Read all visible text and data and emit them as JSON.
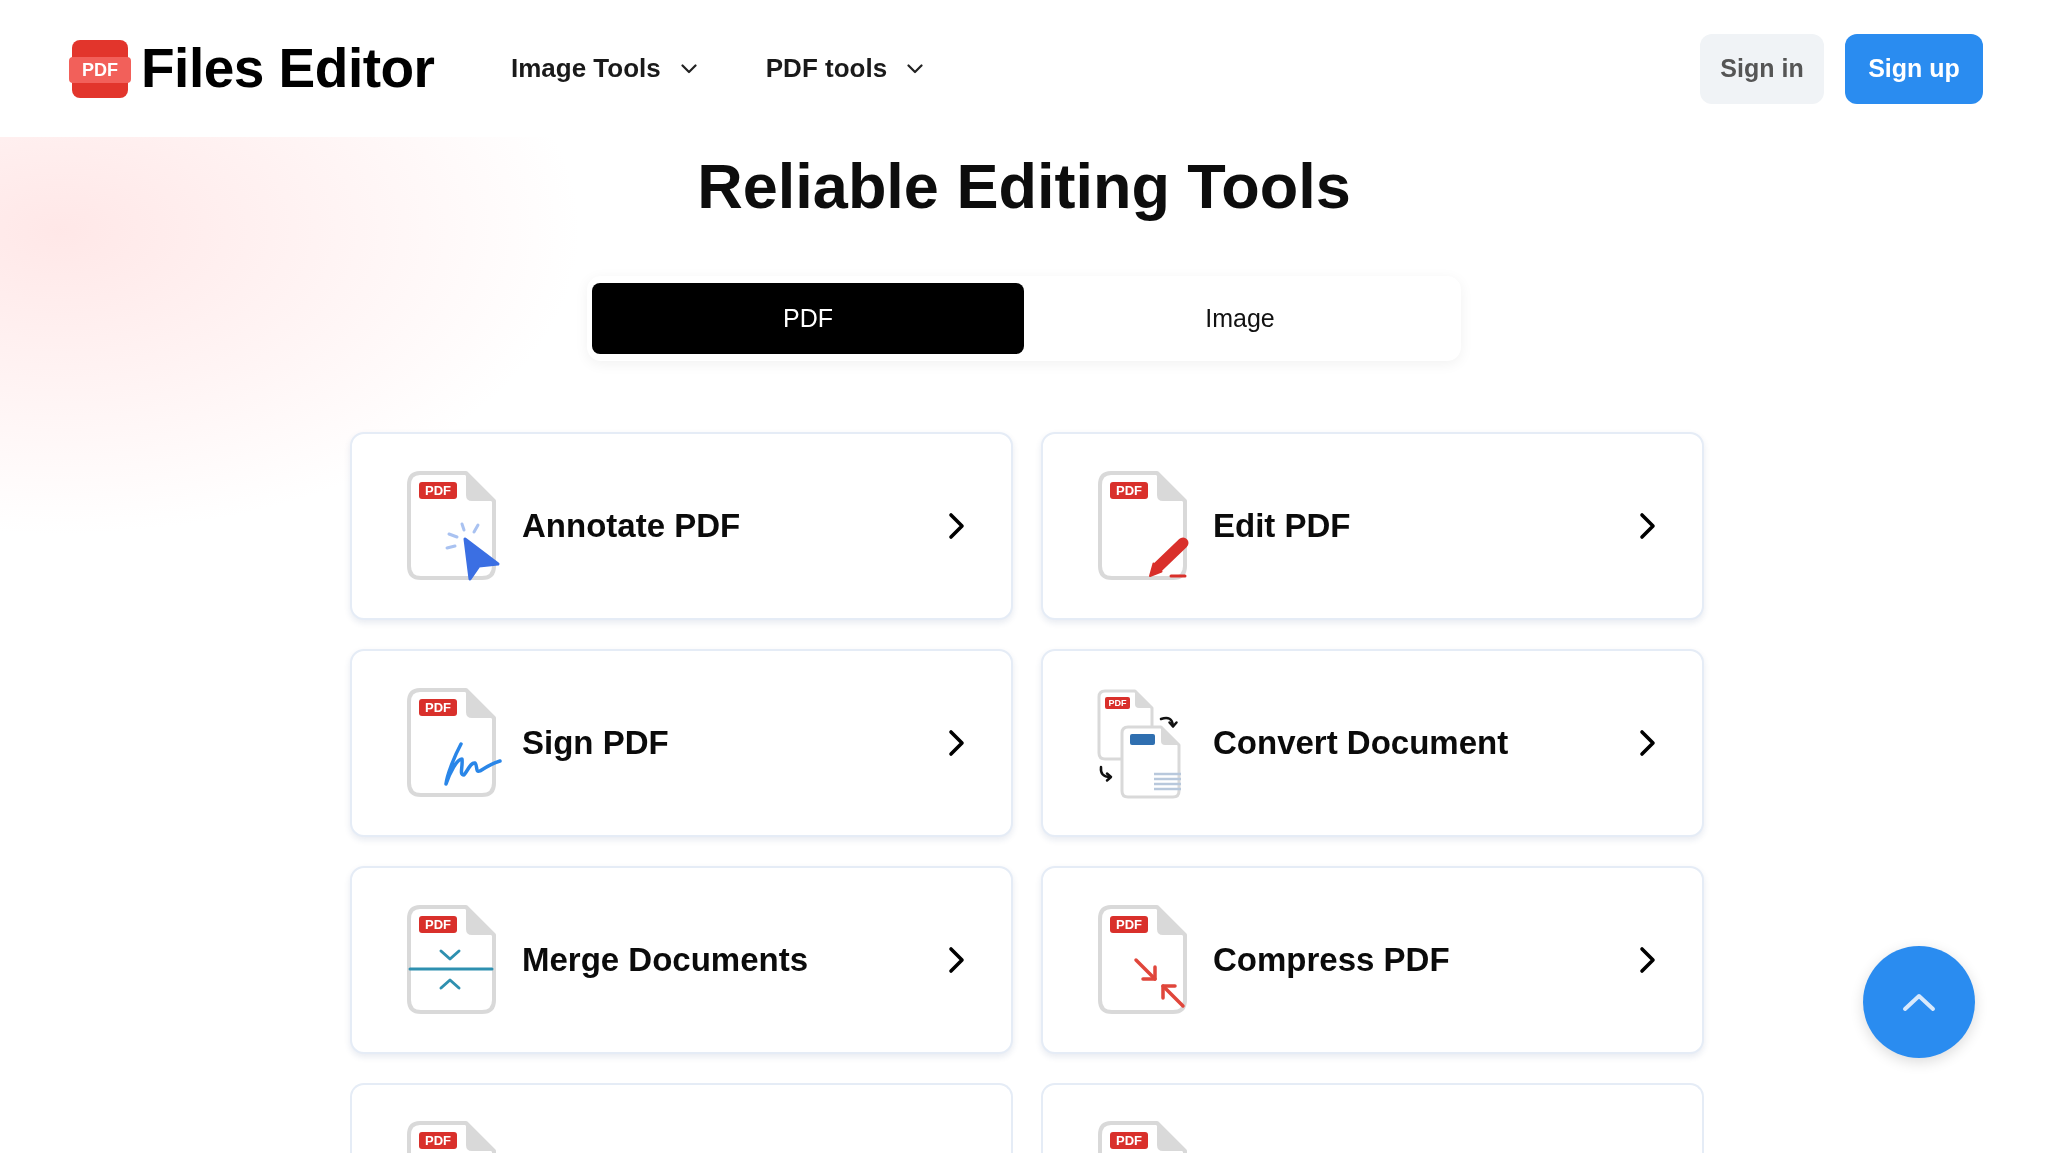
{
  "header": {
    "logo": {
      "badge": "PDF",
      "name": "Files Editor"
    },
    "nav": [
      {
        "label": "Image Tools"
      },
      {
        "label": "PDF tools"
      }
    ],
    "auth_buttons": [
      {
        "label": "Sign in",
        "kind": "secondary"
      },
      {
        "label": "Sign up",
        "kind": "primary"
      }
    ]
  },
  "heading": "Reliable Editing Tools",
  "tabs": [
    {
      "label": "PDF",
      "selected": true
    },
    {
      "label": "Image",
      "selected": false
    }
  ],
  "tools": [
    {
      "kind": "annotate",
      "badge": "PDF",
      "name": "Annotate PDF"
    },
    {
      "kind": "edit",
      "badge": "PDF",
      "name": "Edit PDF"
    },
    {
      "kind": "sign",
      "badge": "PDF",
      "name": "Sign PDF"
    },
    {
      "kind": "convert",
      "badge": "PDF",
      "name": "Convert Document"
    },
    {
      "kind": "merge",
      "badge": "PDF",
      "name": "Merge Documents"
    },
    {
      "kind": "compress",
      "badge": "PDF",
      "name": "Compress PDF"
    },
    {
      "kind": "blank",
      "badge": "PDF"
    },
    {
      "kind": "blank",
      "badge": "PDF"
    }
  ]
}
